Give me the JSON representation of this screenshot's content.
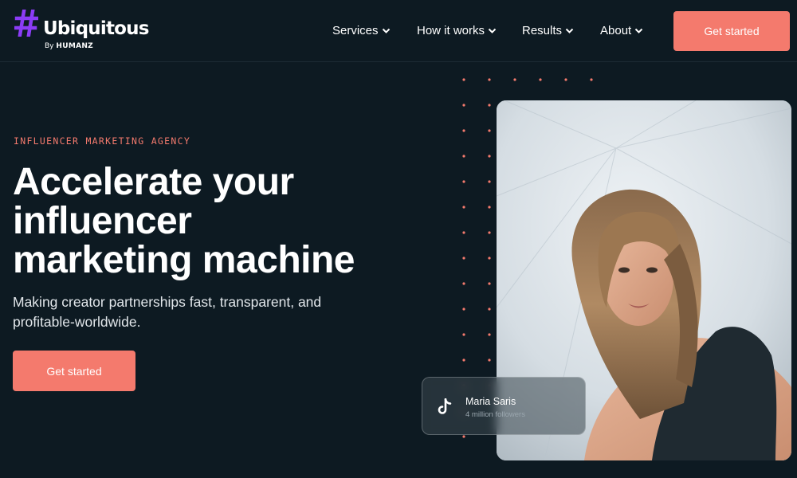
{
  "logo": {
    "wordmark": "Ubiquitous",
    "by_prefix": "By",
    "by_brand": "HUMANZ",
    "accent_color": "#8b3cf6"
  },
  "nav": {
    "items": [
      {
        "label": "Services",
        "icon": "chevron-down-icon"
      },
      {
        "label": "How it works",
        "icon": "chevron-down-icon"
      },
      {
        "label": "Results",
        "icon": "chevron-down-icon"
      },
      {
        "label": "About",
        "icon": "chevron-down-icon"
      }
    ],
    "cta_label": "Get started"
  },
  "hero": {
    "eyebrow": "INFLUENCER MARKETING AGENCY",
    "headline_lines": [
      "Accelerate your",
      "influencer",
      "marketing machine"
    ],
    "subtext": "Making creator partnerships fast, transparent, and profitable-worldwide.",
    "cta_label": "Get started"
  },
  "creator_card": {
    "platform_icon": "tiktok-icon",
    "name": "Maria Saris",
    "followers": "4 million followers"
  },
  "colors": {
    "background": "#0d1a22",
    "accent": "#f47a6d",
    "text": "#ffffff"
  }
}
